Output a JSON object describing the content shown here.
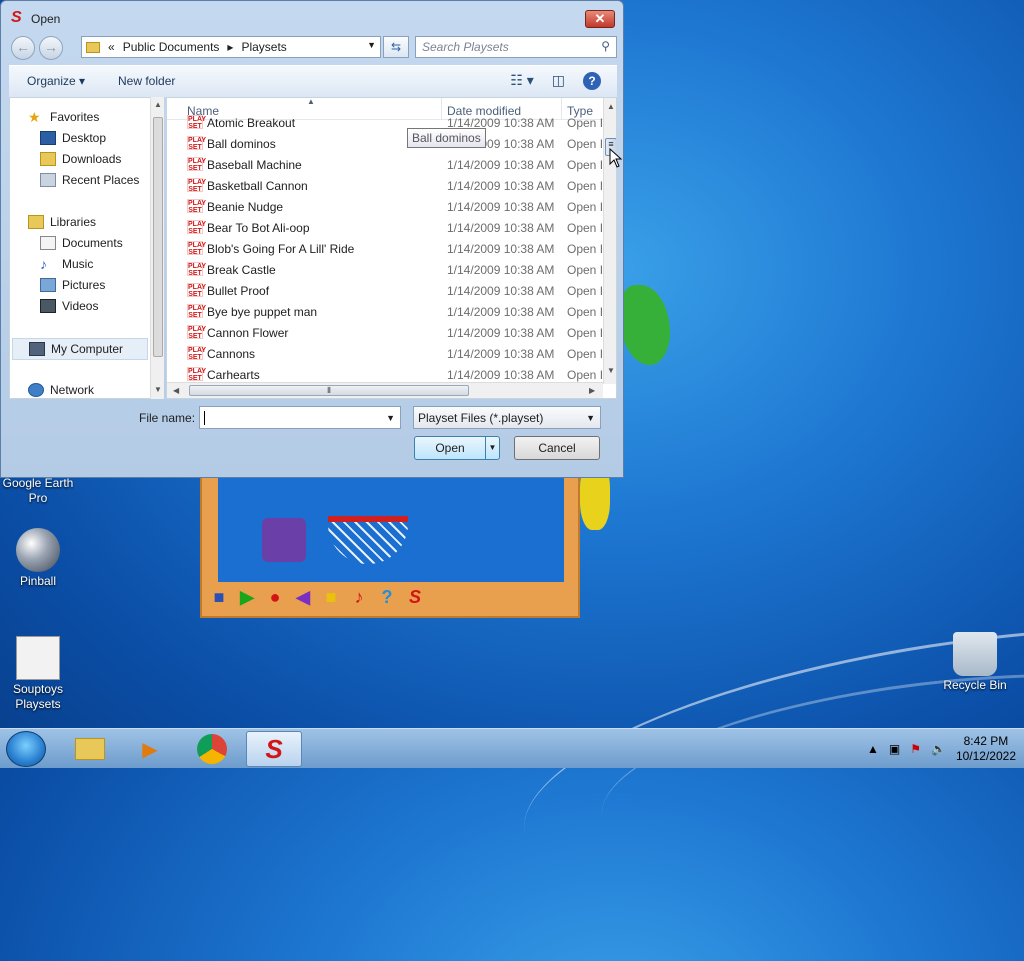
{
  "dialog": {
    "title": "Open",
    "address": {
      "chevron": "«",
      "segments": [
        "Public Documents",
        "Playsets"
      ]
    },
    "search_placeholder": "Search Playsets",
    "toolbar": {
      "organize": "Organize",
      "new_folder": "New folder"
    },
    "nav": {
      "favorites": "Favorites",
      "items_fav": [
        "Desktop",
        "Downloads",
        "Recent Places"
      ],
      "libraries": "Libraries",
      "items_lib": [
        "Documents",
        "Music",
        "Pictures",
        "Videos"
      ],
      "my_computer": "My Computer",
      "network": "Network"
    },
    "columns": {
      "name": "Name",
      "date": "Date modified",
      "type": "Type"
    },
    "tooltip": "Ball dominos",
    "files": [
      {
        "name": "Atomic Breakout",
        "date": "1/14/2009 10:38 AM",
        "type": "Open I"
      },
      {
        "name": "Ball dominos",
        "date": "1/14/2009 10:38 AM",
        "type": "Open I"
      },
      {
        "name": "Baseball Machine",
        "date": "1/14/2009 10:38 AM",
        "type": "Open I"
      },
      {
        "name": "Basketball Cannon",
        "date": "1/14/2009 10:38 AM",
        "type": "Open I"
      },
      {
        "name": "Beanie Nudge",
        "date": "1/14/2009 10:38 AM",
        "type": "Open I"
      },
      {
        "name": "Bear To Bot Ali-oop",
        "date": "1/14/2009 10:38 AM",
        "type": "Open I"
      },
      {
        "name": "Blob's Going For A Lill' Ride",
        "date": "1/14/2009 10:38 AM",
        "type": "Open I"
      },
      {
        "name": "Break Castle",
        "date": "1/14/2009 10:38 AM",
        "type": "Open I"
      },
      {
        "name": "Bullet Proof",
        "date": "1/14/2009 10:38 AM",
        "type": "Open I"
      },
      {
        "name": "Bye bye puppet man",
        "date": "1/14/2009 10:38 AM",
        "type": "Open I"
      },
      {
        "name": "Cannon Flower",
        "date": "1/14/2009 10:38 AM",
        "type": "Open I"
      },
      {
        "name": "Cannons",
        "date": "1/14/2009 10:38 AM",
        "type": "Open I"
      },
      {
        "name": "Carhearts",
        "date": "1/14/2009 10:38 AM",
        "type": "Open I"
      }
    ],
    "file_icon_text": "PLAY SET",
    "file_name_label": "File name:",
    "file_name_value": "",
    "file_type_filter": "Playset Files (*.playset)",
    "open_button": "Open",
    "cancel_button": "Cancel"
  },
  "desktop": {
    "icons": [
      "Google Earth Pro",
      "Pinball",
      "Souptoys Playsets",
      "Recycle Bin"
    ]
  },
  "taskbar": {
    "time": "8:42 PM",
    "date": "10/12/2022"
  }
}
